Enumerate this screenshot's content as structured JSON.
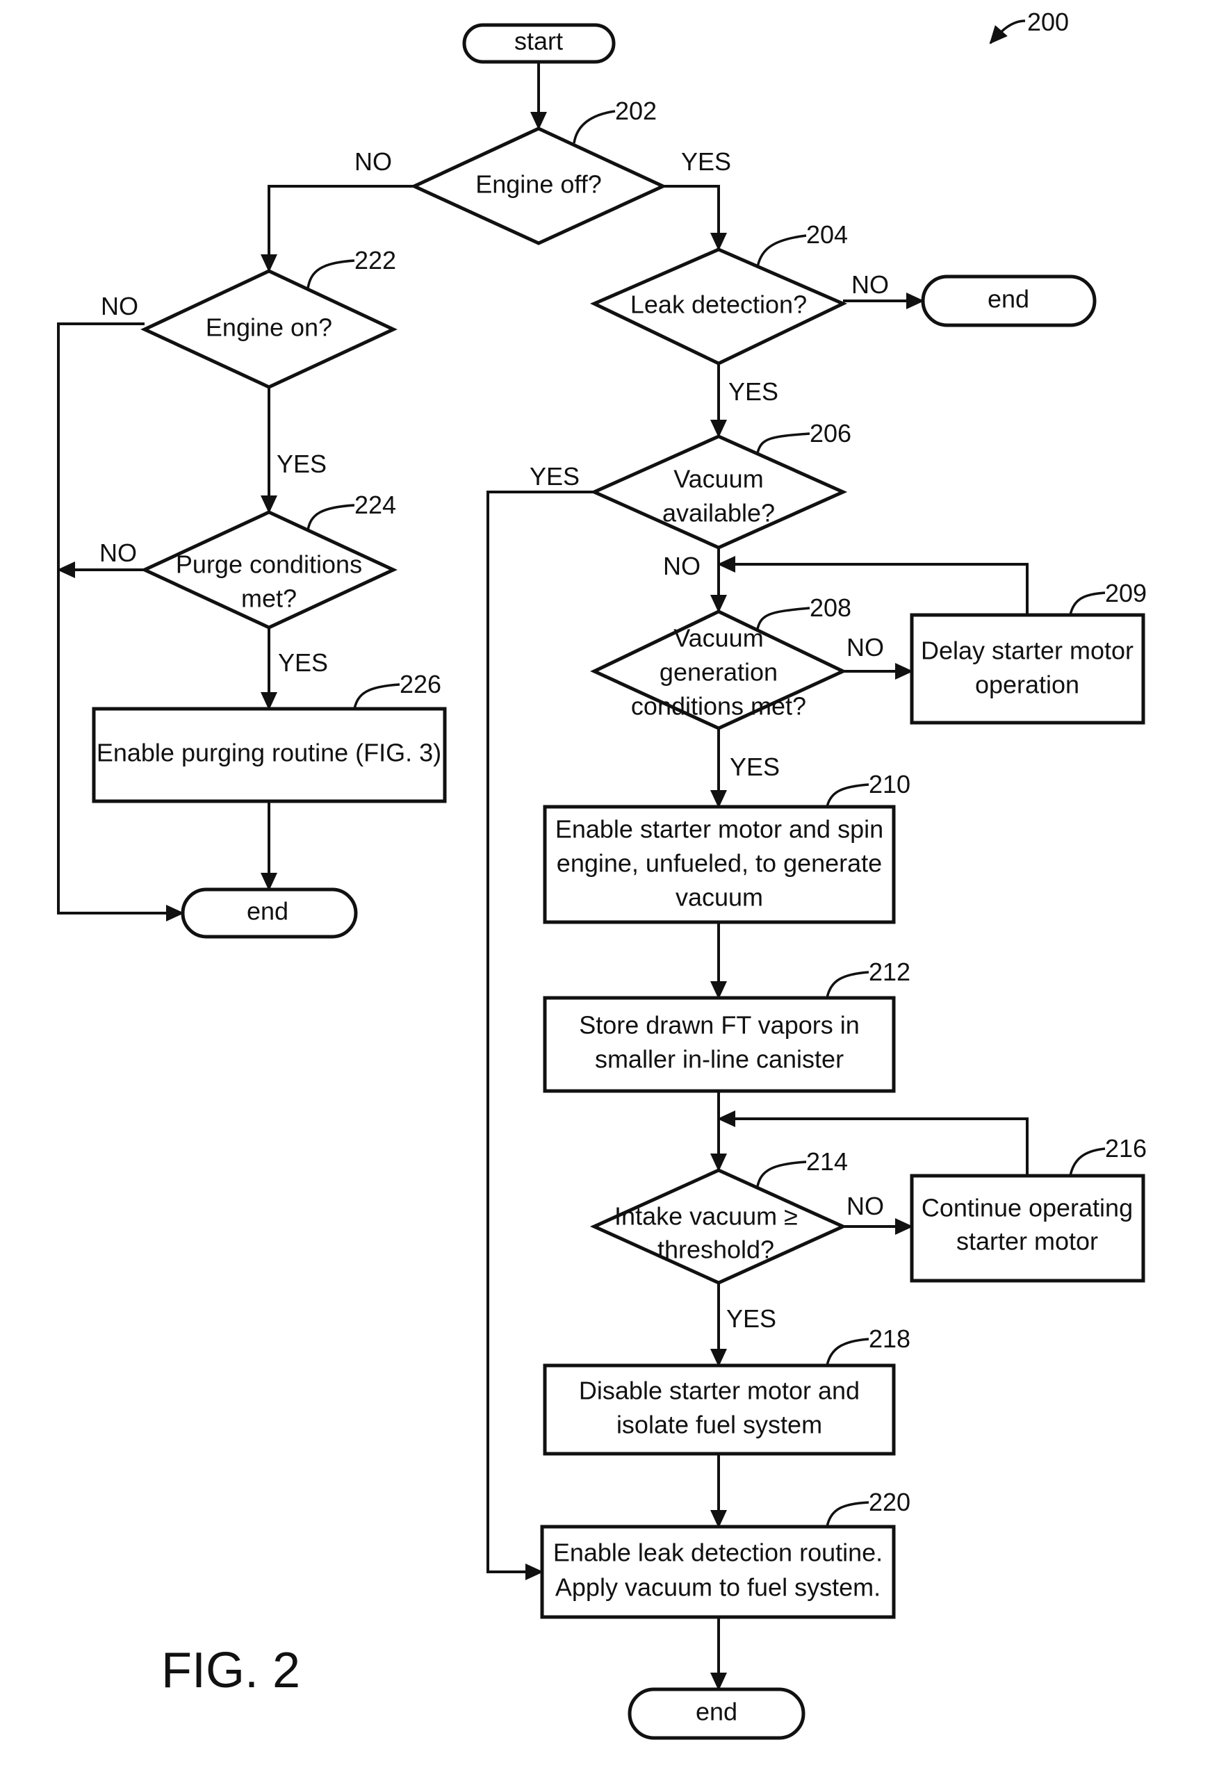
{
  "figure": {
    "reference": "200",
    "caption": "FIG. 2"
  },
  "nodes": {
    "start": {
      "label": [
        "start"
      ]
    },
    "n202": {
      "ref": "202",
      "label": [
        "Engine off?"
      ]
    },
    "n204": {
      "ref": "204",
      "label": [
        "Leak detection?"
      ]
    },
    "end_right": {
      "label": [
        "end"
      ]
    },
    "n206": {
      "ref": "206",
      "label": [
        "Vacuum",
        "available?"
      ]
    },
    "n208": {
      "ref": "208",
      "label": [
        "Vacuum",
        "generation",
        "conditions met?"
      ]
    },
    "n209": {
      "ref": "209",
      "label": [
        "Delay starter motor",
        "operation"
      ]
    },
    "n210": {
      "ref": "210",
      "label": [
        "Enable starter motor and spin",
        "engine, unfueled, to generate",
        "vacuum"
      ]
    },
    "n212": {
      "ref": "212",
      "label": [
        "Store drawn FT vapors in",
        "smaller in-line canister"
      ]
    },
    "n214": {
      "ref": "214",
      "label": [
        "Intake vacuum ≥",
        "threshold?"
      ]
    },
    "n216": {
      "ref": "216",
      "label": [
        "Continue operating",
        "starter motor"
      ]
    },
    "n218": {
      "ref": "218",
      "label": [
        "Disable starter motor and",
        "isolate fuel system"
      ]
    },
    "n220": {
      "ref": "220",
      "label": [
        "Enable leak detection routine.",
        "Apply vacuum to fuel system."
      ]
    },
    "end_bottom": {
      "label": [
        "end"
      ]
    },
    "n222": {
      "ref": "222",
      "label": [
        "Engine on?"
      ]
    },
    "n224": {
      "ref": "224",
      "label": [
        "Purge conditions",
        "met?"
      ]
    },
    "n226": {
      "ref": "226",
      "label": [
        "Enable purging routine (FIG. 3)"
      ]
    },
    "end_left": {
      "label": [
        "end"
      ]
    }
  },
  "edge_labels": {
    "e202_no": "NO",
    "e202_yes": "YES",
    "e204_no": "NO",
    "e204_yes": "YES",
    "e206_yes": "YES",
    "e206_no": "NO",
    "e208_no": "NO",
    "e208_yes": "YES",
    "e214_no": "NO",
    "e214_yes": "YES",
    "e222_no": "NO",
    "e222_yes": "YES",
    "e224_no": "NO",
    "e224_yes": "YES"
  }
}
